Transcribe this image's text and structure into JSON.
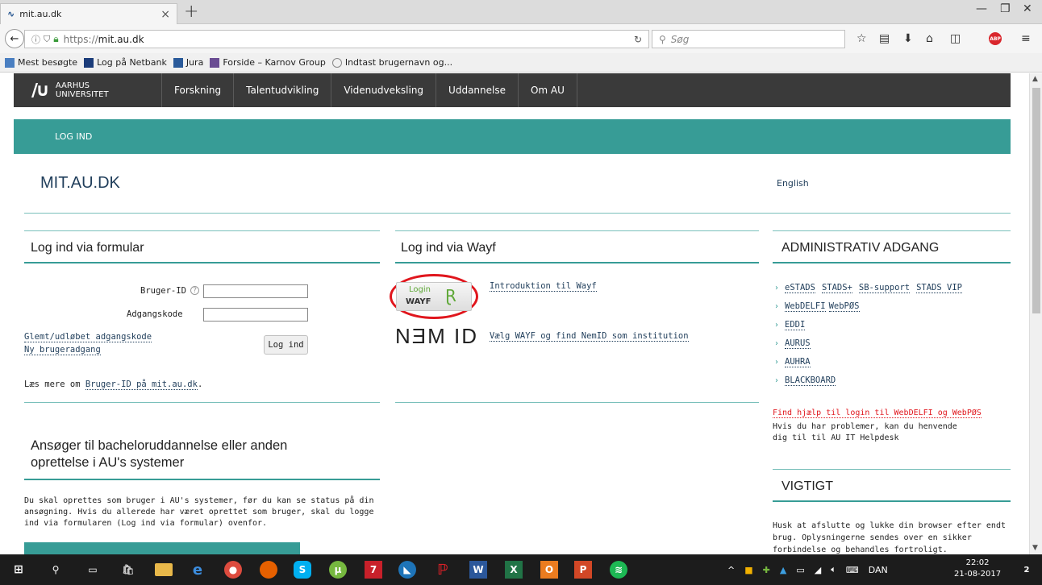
{
  "browser": {
    "tab_title": "mit.au.dk",
    "url_prefix": "https://",
    "url_domain": "mit.au.dk",
    "search_placeholder": "Søg",
    "bookmarks": [
      "Mest besøgte",
      "Log på Netbank",
      "Jura",
      "Forside – Karnov Group",
      "Indtast brugernavn og..."
    ]
  },
  "site": {
    "logo_line1": "AARHUS",
    "logo_line2": "UNIVERSITET",
    "nav": [
      "Forskning",
      "Talentudvikling",
      "Videnudveksling",
      "Uddannelse",
      "Om AU"
    ],
    "teal_label": "LOG IND",
    "title": "MIT.AU.DK",
    "english": "English"
  },
  "form_col": {
    "heading": "Log ind via formular",
    "userid_label": "Bruger-ID",
    "help": "?",
    "password_label": "Adgangskode",
    "forgot": "Glemt/udløbet adgangskode",
    "new_user": "Ny brugeradgang",
    "login_button": "Log ind",
    "read_more_prefix": "Læs mere om",
    "read_more_link": "Bruger-ID på mit.au.dk",
    "read_more_suffix": ".",
    "applicant_heading": "Ansøger til bacheloruddannelse eller anden oprettelse i AU's systemer",
    "applicant_text": "Du skal oprettes som bruger i AU's systemer, før du kan se status på din ansøgning. Hvis du allerede har været oprettet som bruger, skal du logge ind via formularen (Log ind via formular) ovenfor."
  },
  "wayf_col": {
    "heading": "Log ind via Wayf",
    "wayf_login": "Login",
    "wayf_brand": "WAYF",
    "intro_link": "Introduktion til Wayf",
    "nemid_logo": "NƎM ID",
    "nemid_link": "Vælg WAYF og find NemID som institution"
  },
  "admin_col": {
    "heading": "ADMINISTRATIV ADGANG",
    "rows": [
      [
        "eSTADS",
        "STADS+",
        "SB-support",
        "STADS VIP"
      ],
      [
        "WebDELFI",
        "WebPØS"
      ],
      [
        "EDDI"
      ],
      [
        "AURUS"
      ],
      [
        "AUHRA"
      ],
      [
        "BLACKBOARD"
      ]
    ],
    "help_link": "Find hjælp til login til WebDELFI og WebPØS",
    "help_text": "Hvis du har problemer, kan du henvende dig til til AU IT Helpdesk",
    "important_heading": "VIGTIGT",
    "important_text": "Husk at afslutte og lukke din browser efter endt brug. Oplysningerne sendes over en sikker forbindelse og behandles fortroligt."
  },
  "taskbar": {
    "language": "DAN",
    "time": "22:02",
    "date": "21-08-2017",
    "notifications": "2"
  }
}
